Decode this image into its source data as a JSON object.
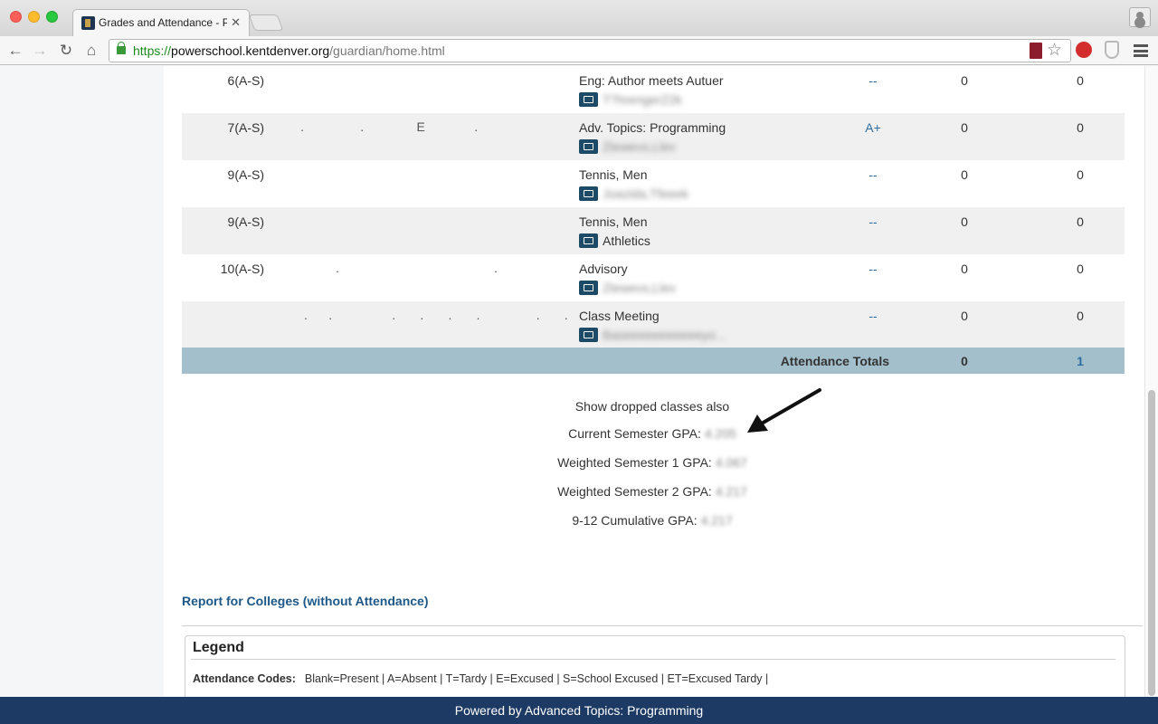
{
  "browser": {
    "tab_title": "Grades and Attendance - P",
    "tab_close": "✕",
    "url_scheme": "https://",
    "url_host": "powerschool.kentdenver.org",
    "url_path": "/guardian/home.html",
    "icons": {
      "back": "arrow-left-icon",
      "forward": "arrow-right-icon",
      "reload": "reload-icon",
      "home": "home-icon",
      "bookmark": "star-icon",
      "menu": "hamburger-menu-icon"
    }
  },
  "table": {
    "rows": [
      {
        "period": "6(A-S)",
        "dots": "",
        "course": "Eng: Author meets Autuer",
        "teacher": "T?hrengerZ2k",
        "grade": "--",
        "absences": "0",
        "tardies": "0"
      },
      {
        "period": "7(A-S)",
        "dots": "        .                .               E              .",
        "course": "Adv. Topics: Programming",
        "teacher": "Zlewevs,Llev",
        "grade": "A+",
        "absences": "0",
        "tardies": "0"
      },
      {
        "period": "9(A-S)",
        "dots": "",
        "course": "Tennis, Men",
        "teacher": "Joazida,Tfeeek",
        "grade": "--",
        "absences": "0",
        "tardies": "0"
      },
      {
        "period": "9(A-S)",
        "dots": "",
        "course": "Tennis, Men",
        "teacher": "Athletics",
        "grade": "--",
        "absences": "0",
        "tardies": "0"
      },
      {
        "period": "10(A-S)",
        "dots": "                  .                                            .",
        "course": "Advisory",
        "teacher": "Zlewevs,Llev",
        "grade": "--",
        "absences": "0",
        "tardies": "0"
      },
      {
        "period": "",
        "dots": "         .      .                 .       .       .       .                .       .",
        "course": "Class Meeting",
        "teacher": "Baseeeeeeeeeeeyo...",
        "grade": "--",
        "absences": "0",
        "tardies": "0"
      }
    ],
    "totals_label": "Attendance Totals",
    "totals_absences": "0",
    "totals_tardies": "1"
  },
  "gpa": {
    "show_dropped": "Show dropped classes also",
    "current_label": "Current Semester GPA:",
    "current_value": "4.205",
    "w1_label": "Weighted Semester 1 GPA:",
    "w1_value": "4.067",
    "w2_label": "Weighted Semester 2 GPA:",
    "w2_value": "4.217",
    "cumulative_label": "9-12 Cumulative GPA:",
    "cumulative_value": "4.217"
  },
  "colleges_link": "Report for Colleges (without Attendance)",
  "legend": {
    "title": "Legend",
    "codes_label": "Attendance Codes:",
    "codes_text": "Blank=Present | A=Absent | T=Tardy | E=Excused | S=School Excused | ET=Excused Tardy |"
  },
  "footer": "Powered by Advanced Topics: Programming"
}
